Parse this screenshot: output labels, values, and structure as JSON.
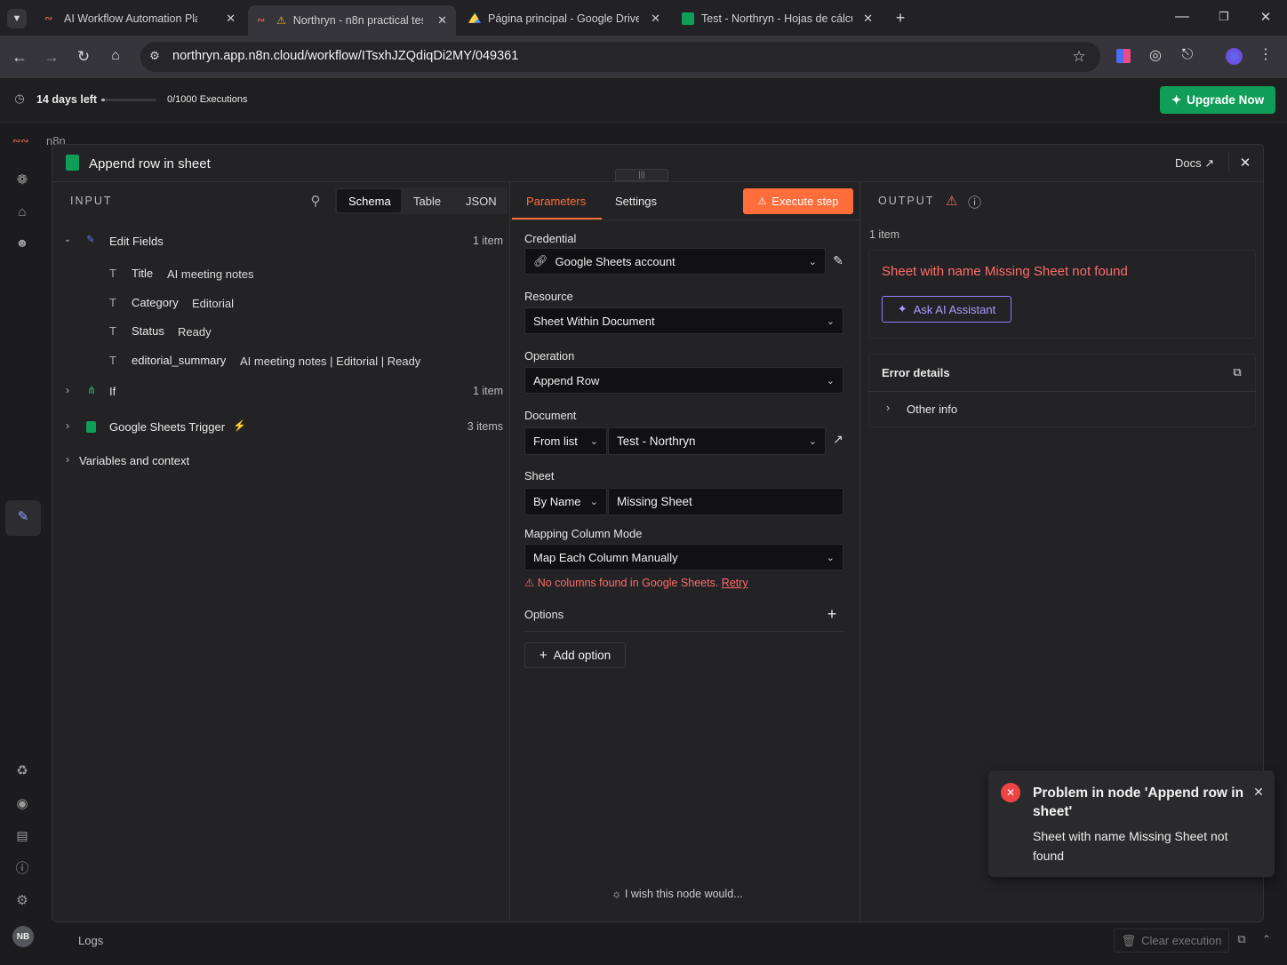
{
  "browser": {
    "tabs": [
      {
        "title": "AI Workflow Automation Platfo",
        "active": false
      },
      {
        "title": "Northryn - n8n practical tes",
        "active": true
      },
      {
        "title": "Página principal - Google Drive",
        "active": false
      },
      {
        "title": "Test - Northryn - Hojas de cálcu",
        "active": false
      }
    ],
    "url": "northryn.app.n8n.cloud/workflow/ITsxhJZQdiqDi2MY/049361"
  },
  "trial": {
    "days_left": "14 days left",
    "executions": "0/1000 Executions",
    "upgrade_label": "Upgrade Now"
  },
  "app": {
    "brand": "n8n",
    "user_initials": "NB"
  },
  "modal": {
    "title": "Append row in sheet",
    "docs_label": "Docs",
    "input": {
      "heading": "INPUT",
      "view_tabs": [
        "Schema",
        "Table",
        "JSON"
      ],
      "edit_fields": {
        "label": "Edit Fields",
        "count": "1 item",
        "fields": [
          {
            "name": "Title",
            "value": "AI meeting notes"
          },
          {
            "name": "Category",
            "value": "Editorial"
          },
          {
            "name": "Status",
            "value": "Ready"
          },
          {
            "name": "editorial_summary",
            "value": "AI meeting notes | Editorial | Ready"
          }
        ]
      },
      "if_node": {
        "label": "If",
        "count": "1 item"
      },
      "trigger": {
        "label": "Google Sheets Trigger",
        "count": "3 items"
      },
      "variables_label": "Variables and context"
    },
    "params": {
      "tab_parameters": "Parameters",
      "tab_settings": "Settings",
      "execute_label": "Execute step",
      "credential_label": "Credential",
      "credential_value": "Google Sheets account",
      "resource_label": "Resource",
      "resource_value": "Sheet Within Document",
      "operation_label": "Operation",
      "operation_value": "Append Row",
      "document_label": "Document",
      "document_mode": "From list",
      "document_value": "Test - Northryn",
      "sheet_label": "Sheet",
      "sheet_mode": "By Name",
      "sheet_value": "Missing Sheet",
      "mapping_label": "Mapping Column Mode",
      "mapping_value": "Map Each Column Manually",
      "mapping_warning": "No columns found in Google Sheets.",
      "retry_label": "Retry",
      "options_label": "Options",
      "add_option_label": "Add option",
      "feedback_label": "I wish this node would..."
    },
    "output": {
      "heading": "OUTPUT",
      "count": "1 item",
      "error_message": "Sheet with name Missing Sheet not found",
      "ask_ai_label": "Ask AI Assistant",
      "error_details_label": "Error details",
      "other_info_label": "Other info"
    }
  },
  "toast": {
    "title": "Problem in node 'Append row in sheet'",
    "message": "Sheet with name Missing Sheet not found"
  },
  "footer": {
    "logs_label": "Logs",
    "clear_label": "Clear execution"
  },
  "colors": {
    "accent_orange": "#ff6d3b",
    "error_red": "#ff6b6b",
    "upgrade_green": "#0f9d58",
    "ai_purple": "#9b8cff"
  }
}
